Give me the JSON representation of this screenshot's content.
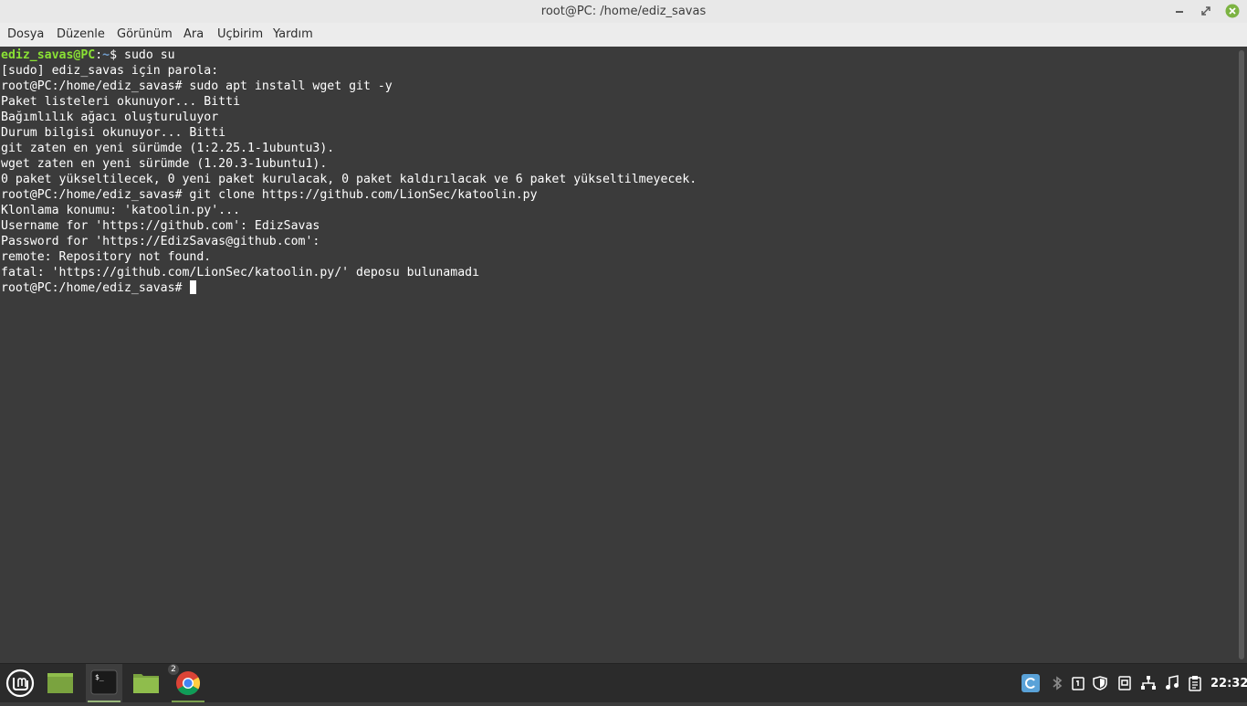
{
  "window": {
    "title": "root@PC: /home/ediz_savas",
    "controls": [
      "minimize-icon",
      "maximize-icon",
      "close-icon"
    ]
  },
  "menu": {
    "items": [
      "Dosya",
      "Düzenle",
      "Görünüm",
      "Ara",
      "Uçbirim",
      "Yardım"
    ]
  },
  "terminal": {
    "prompt_user": "ediz_savas@PC",
    "prompt_path": "~",
    "first_command": " sudo su",
    "lines": [
      "[sudo] ediz_savas için parola:",
      "root@PC:/home/ediz_savas# sudo apt install wget git -y",
      "Paket listeleri okunuyor... Bitti",
      "Bağımlılık ağacı oluşturuluyor",
      "Durum bilgisi okunuyor... Bitti",
      "git zaten en yeni sürümde (1:2.25.1-1ubuntu3).",
      "wget zaten en yeni sürümde (1.20.3-1ubuntu1).",
      "0 paket yükseltilecek, 0 yeni paket kurulacak, 0 paket kaldırılacak ve 6 paket yükseltilmeyecek.",
      "root@PC:/home/ediz_savas# git clone https://github.com/LionSec/katoolin.py",
      "Klonlama konumu: 'katoolin.py'...",
      "Username for 'https://github.com': EdizSavas",
      "Password for 'https://EdizSavas@github.com':",
      "remote: Repository not found.",
      "fatal: 'https://github.com/LionSec/katoolin.py/' deposu bulunamadı"
    ],
    "current_prompt": "root@PC:/home/ediz_savas# "
  },
  "taskbar": {
    "apps": [
      {
        "name": "mint-menu-icon"
      },
      {
        "name": "show-desktop-icon"
      },
      {
        "name": "terminal-icon"
      },
      {
        "name": "files-icon"
      },
      {
        "name": "chrome-icon",
        "badge": "2"
      }
    ],
    "tray": [
      "update-manager-icon",
      "bluetooth-icon",
      "notes-icon",
      "shield-icon",
      "display-icon",
      "network-icon",
      "volume-icon",
      "clipboard-icon"
    ],
    "clock": "22:32"
  },
  "colors": {
    "terminal_bg": "#3b3b3b",
    "prompt_user": "#8ae234",
    "prompt_path": "#729fcf",
    "taskbar_bg": "#2b2b2b",
    "accent": "#9ab87c"
  }
}
